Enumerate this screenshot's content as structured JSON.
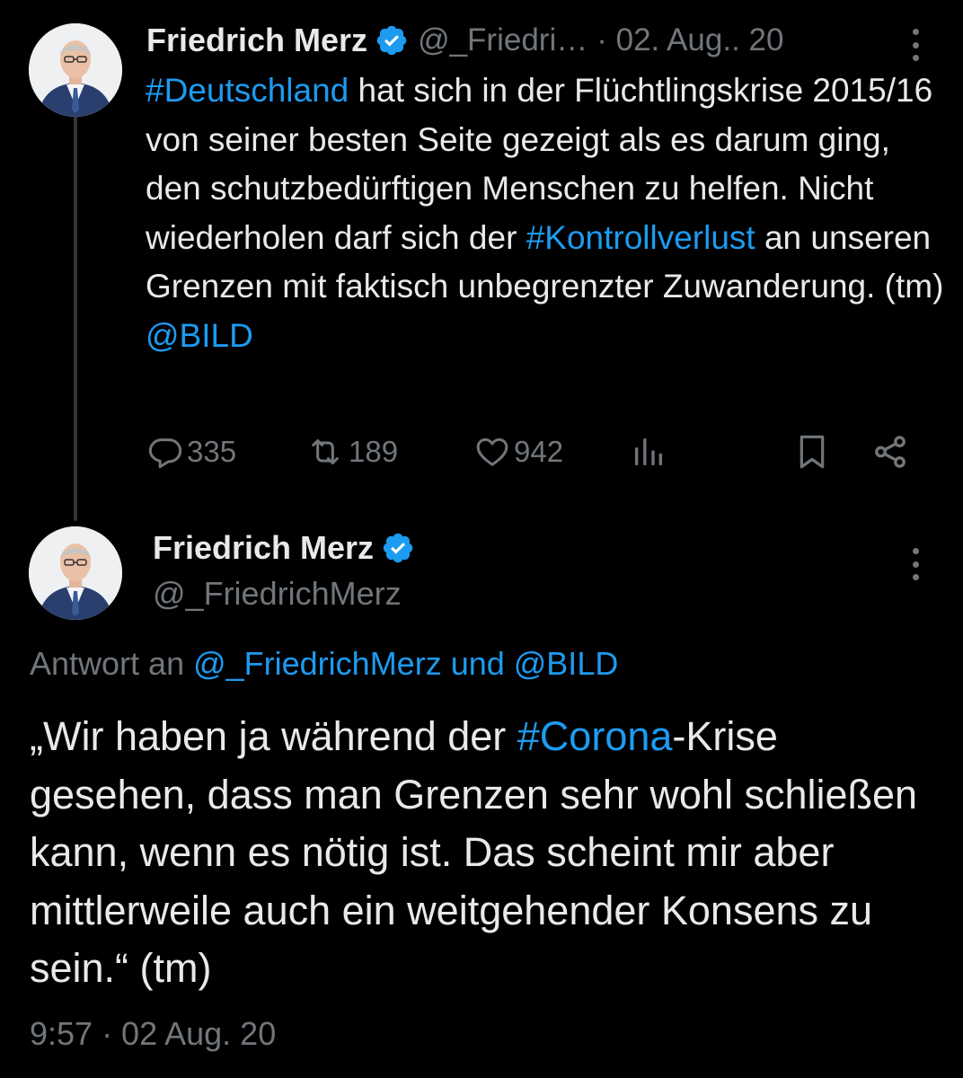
{
  "thread": {
    "parent": {
      "author_name": "Friedrich Merz",
      "handle": "@_Friedri…",
      "separator": "·",
      "date": "02. Aug.. 20",
      "text": {
        "hashtag_1": "#Deutschland",
        "part_1": " hat sich in der Flüchtlingskrise 2015/16 von seiner besten Seite gezeigt als es darum ging, den schutzbedürftigen Menschen zu helfen. Nicht wiederholen darf sich der ",
        "hashtag_2": "#Kontrollverlust",
        "part_2": " an unseren Grenzen mit faktisch unbegrenzter Zuwanderung. (tm) ",
        "mention": "@BILD"
      },
      "actions": {
        "replies": "335",
        "reposts": "189",
        "likes": "942"
      }
    },
    "reply": {
      "author_name": "Friedrich Merz",
      "handle": "@_FriedrichMerz",
      "reply_to": {
        "prefix": "Antwort an ",
        "users": "@_FriedrichMerz und @BILD"
      },
      "text": {
        "part_1": "„Wir haben ja während der ",
        "hashtag": "#Corona",
        "part_2": "-Krise gesehen, dass man Grenzen sehr wohl schließen kann, wenn es nötig ist. Das scheint mir aber mittlerweile auch ein weitgehender Konsens zu sein.“ (tm)"
      },
      "timestamp": "9:57 · 02 Aug. 20"
    }
  },
  "icons": {
    "verified": "verified-badge-icon",
    "more": "more-options-icon",
    "reply": "reply-icon",
    "repost": "repost-icon",
    "like": "like-icon",
    "views": "views-icon",
    "bookmark": "bookmark-icon",
    "share": "share-icon"
  },
  "colors": {
    "background": "#000000",
    "text": "#e7e9ea",
    "secondary": "#71767b",
    "link": "#1d9bf0",
    "thread_line": "#333639"
  }
}
